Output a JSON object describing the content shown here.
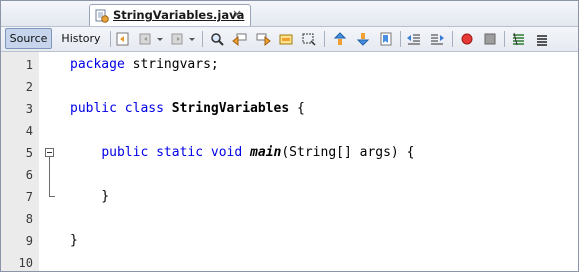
{
  "tab": {
    "label": "StringVariables.java",
    "close": "×"
  },
  "toolbar": {
    "source_label": "Source",
    "history_label": "History"
  },
  "editor": {
    "line_numbers": [
      "1",
      "2",
      "3",
      "4",
      "5",
      "6",
      "7",
      "8",
      "9",
      "10"
    ],
    "lines": [
      [
        {
          "t": "package",
          "c": "kw"
        },
        {
          "t": " stringvars;",
          "c": ""
        }
      ],
      [],
      [
        {
          "t": "public",
          "c": "kw"
        },
        {
          "t": " ",
          "c": ""
        },
        {
          "t": "class",
          "c": "kw"
        },
        {
          "t": " ",
          "c": ""
        },
        {
          "t": "StringVariables",
          "c": "cls"
        },
        {
          "t": " {",
          "c": ""
        }
      ],
      [],
      [
        {
          "t": "    ",
          "c": ""
        },
        {
          "t": "public",
          "c": "kw"
        },
        {
          "t": " ",
          "c": ""
        },
        {
          "t": "static",
          "c": "kw"
        },
        {
          "t": " ",
          "c": ""
        },
        {
          "t": "void",
          "c": "kw"
        },
        {
          "t": " ",
          "c": ""
        },
        {
          "t": "main",
          "c": "method"
        },
        {
          "t": "(String[] args) {",
          "c": ""
        }
      ],
      [],
      [
        {
          "t": "    }",
          "c": ""
        }
      ],
      [],
      [
        {
          "t": "}",
          "c": ""
        }
      ],
      []
    ]
  },
  "colors": {
    "keyword": "#0000e6",
    "gutter_bg": "#ebebeb",
    "source_button_bg": "#c6d5ec"
  },
  "icons": [
    "java-file-icon",
    "last-edit-icon",
    "back-icon",
    "forward-icon",
    "find-selection-icon",
    "find-previous-icon",
    "find-next-icon",
    "toggle-highlight-icon",
    "toggle-rectangular-selection-icon",
    "previous-bookmark-icon",
    "next-bookmark-icon",
    "toggle-bookmark-icon",
    "shift-left-icon",
    "shift-right-icon",
    "start-macro-icon",
    "stop-macro-icon",
    "comment-icon",
    "uncomment-icon"
  ]
}
